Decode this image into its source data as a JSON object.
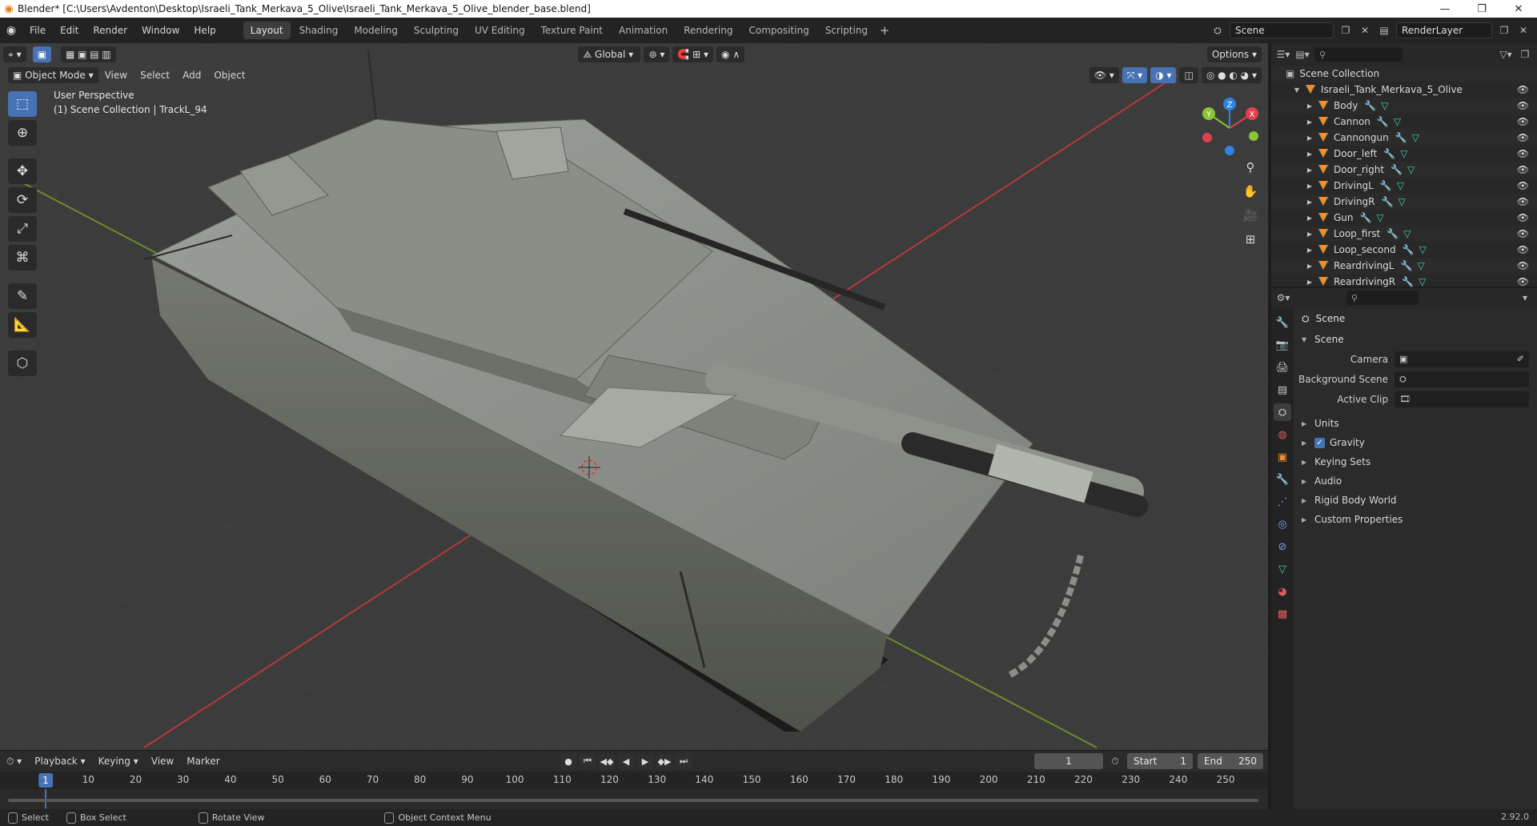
{
  "window": {
    "title": "Blender* [C:\\Users\\Avdenton\\Desktop\\Israeli_Tank_Merkava_5_Olive\\Israeli_Tank_Merkava_5_Olive_blender_base.blend]",
    "controls": [
      "—",
      "❐",
      "✕"
    ]
  },
  "menu": [
    "File",
    "Edit",
    "Render",
    "Window",
    "Help"
  ],
  "workspaces": [
    "Layout",
    "Shading",
    "Modeling",
    "Sculpting",
    "UV Editing",
    "Texture Paint",
    "Animation",
    "Rendering",
    "Compositing",
    "Scripting"
  ],
  "active_workspace": "Layout",
  "scene_field": "Scene",
  "view_layer_field": "RenderLayer",
  "viewport": {
    "mode": "Object Mode",
    "menus": [
      "View",
      "Select",
      "Add",
      "Object"
    ],
    "transform_orientation": "Global",
    "options_label": "Options",
    "info_line1": "User Perspective",
    "info_line2": "(1) Scene Collection | TrackL_94",
    "gizmo_axes": {
      "x": "X",
      "y": "Y",
      "z": "Z"
    }
  },
  "timeline": {
    "menus": [
      "Playback",
      "Keying",
      "View",
      "Marker"
    ],
    "current_frame": "1",
    "start_label": "Start",
    "start": "1",
    "end_label": "End",
    "end": "250",
    "ruler": [
      "1",
      "10",
      "20",
      "30",
      "40",
      "50",
      "60",
      "70",
      "80",
      "90",
      "100",
      "110",
      "120",
      "130",
      "140",
      "150",
      "160",
      "170",
      "180",
      "190",
      "200",
      "210",
      "220",
      "230",
      "240",
      "250"
    ]
  },
  "statusbar": {
    "select": "Select",
    "box_select": "Box Select",
    "rotate_view": "Rotate View",
    "context_menu": "Object Context Menu",
    "version": "2.92.0"
  },
  "outliner": {
    "root": "Scene Collection",
    "collection": "Israeli_Tank_Merkava_5_Olive",
    "items": [
      "Body",
      "Cannon",
      "Cannongun",
      "Door_left",
      "Door_right",
      "DrivingL",
      "DrivingR",
      "Gun",
      "Loop_first",
      "Loop_second",
      "ReardrivingL",
      "ReardrivingR"
    ]
  },
  "properties": {
    "context": "Scene",
    "panel_title": "Scene",
    "camera_label": "Camera",
    "background_label": "Background Scene",
    "active_clip_label": "Active Clip",
    "panels": [
      "Units",
      "Gravity",
      "Keying Sets",
      "Audio",
      "Rigid Body World",
      "Custom Properties"
    ],
    "gravity_checked": true
  },
  "colors": {
    "accent": "#4772b3",
    "viewport_bg": "#3b3b3b",
    "object_icon": "#e79035",
    "axis_x": "#e0414f",
    "axis_y": "#8ac536",
    "axis_z": "#2f83e3"
  }
}
